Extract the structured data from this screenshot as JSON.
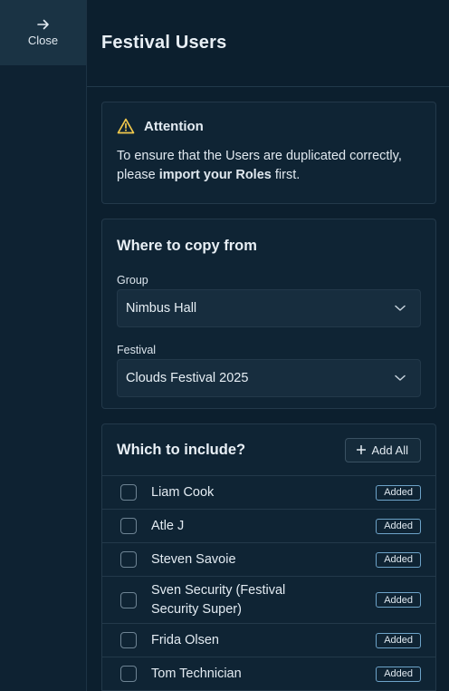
{
  "nav": {
    "close_label": "Close"
  },
  "header": {
    "title": "Festival Users"
  },
  "attention": {
    "title": "Attention",
    "text_before": "To ensure that the Users are duplicated correctly, please ",
    "text_bold": "import your Roles",
    "text_after": " first."
  },
  "copy_from": {
    "title": "Where to copy from",
    "group_label": "Group",
    "group_value": "Nimbus Hall",
    "festival_label": "Festival",
    "festival_value": "Clouds Festival 2025"
  },
  "include": {
    "title": "Which to include?",
    "add_all_label": "Add All",
    "users": [
      {
        "name": "Liam Cook",
        "status": "Added"
      },
      {
        "name": "Atle J",
        "status": "Added"
      },
      {
        "name": "Steven Savoie",
        "status": "Added"
      },
      {
        "name": "Sven Security (Festival Security Super)",
        "status": "Added"
      },
      {
        "name": "Frida Olsen",
        "status": "Added"
      },
      {
        "name": "Tom Technician",
        "status": "Added"
      }
    ]
  },
  "colors": {
    "background": "#0c1f2e",
    "card": "#0f2434",
    "warning": "#f2c94c",
    "badge_border": "#6da3c8"
  },
  "icons": {
    "close": "arrow-right-icon",
    "attention": "warning-triangle-icon",
    "select": "chevron-down-icon",
    "add": "plus-icon"
  }
}
